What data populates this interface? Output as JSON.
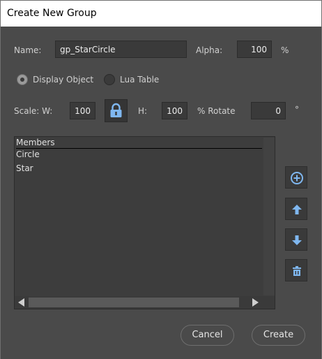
{
  "window": {
    "title": "Create New Group"
  },
  "form": {
    "name_label": "Name:",
    "name_value": "gp_StarCircle",
    "alpha_label": "Alpha:",
    "alpha_value": "100",
    "alpha_unit": "%",
    "display_object_label": "Display Object",
    "lua_table_label": "Lua Table",
    "selected_type": "Display Object",
    "scale_w_label": "Scale: W:",
    "scale_w_value": "100",
    "h_label": "H:",
    "h_value": "100",
    "rotate_label": "% Rotate",
    "rotate_value": "0",
    "rotate_unit": "°",
    "lock_icon": "lock-icon"
  },
  "members": {
    "header": "Members",
    "items": [
      "Circle",
      "Star"
    ]
  },
  "side_buttons": {
    "add_icon": "plus-circle-icon",
    "up_icon": "arrow-up-icon",
    "down_icon": "arrow-down-icon",
    "delete_icon": "trash-icon"
  },
  "buttons": {
    "cancel": "Cancel",
    "create": "Create"
  },
  "colors": {
    "background": "#4a4a4a",
    "accent_icon": "#7fb7f0",
    "field": "#3a3a3a"
  }
}
